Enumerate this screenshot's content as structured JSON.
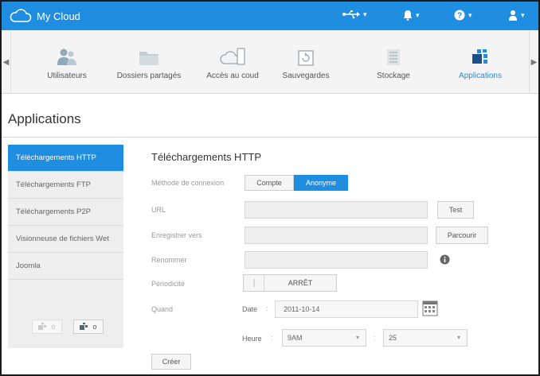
{
  "app": {
    "title": "My Cloud"
  },
  "topbar": {
    "usb_glyph": "⭍",
    "bell_glyph": "🔔",
    "help_glyph": "?",
    "user_glyph": "👤",
    "caret": "▾"
  },
  "nav": {
    "items": [
      {
        "label": "Utilisateurs",
        "icon": "users-icon"
      },
      {
        "label": "Dossiers partagés",
        "icon": "folder-icon"
      },
      {
        "label": "Accès au coud",
        "icon": "cloud-device-icon"
      },
      {
        "label": "Sauvegardes",
        "icon": "backup-icon"
      },
      {
        "label": "Stockage",
        "icon": "storage-icon"
      },
      {
        "label": "Applications",
        "icon": "apps-icon",
        "active": true
      }
    ]
  },
  "page": {
    "title": "Applications"
  },
  "left_menu": {
    "items": [
      {
        "label": "Téléchargements HTTP",
        "active": true
      },
      {
        "label": "Téléchargements FTP"
      },
      {
        "label": "Téléchargements P2P"
      },
      {
        "label": "Visionneuse de fichiers Wet"
      },
      {
        "label": "Joomla"
      }
    ],
    "remove_button_text": "o",
    "add_button_text": "o"
  },
  "form": {
    "title": "Téléchargements HTTP",
    "method_label": "Méthode de connexion",
    "method_options": [
      "Compte",
      "Anonyme"
    ],
    "url_label": "URL",
    "url_value": "",
    "test_button": "Test",
    "save_to_label": "Enregistrer vers",
    "save_to_value": "",
    "browse_button": "Parcourir",
    "rename_label": "Renommer",
    "rename_value": "",
    "periodicity_label": "Périodicité",
    "periodicity_value": "ARRÊT",
    "when_label": "Quand",
    "date_label": "Date",
    "date_value": "2011-10-14",
    "time_label": "Heure",
    "hour_value": "9AM",
    "minute_value": "25",
    "create_button": "Créer"
  },
  "colors": {
    "accent": "#1f8de0"
  }
}
